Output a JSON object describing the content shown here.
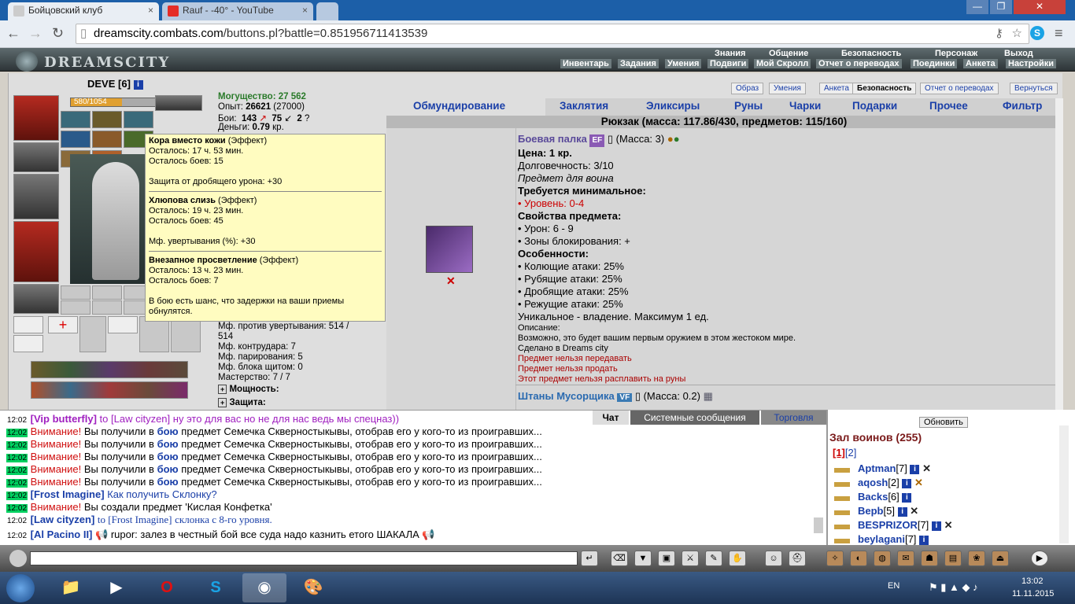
{
  "browser": {
    "tabs": [
      {
        "label": "Бойцовский клуб",
        "close": "×"
      },
      {
        "label": "Rauf - -40° - YouTube",
        "close": "×"
      }
    ],
    "window_buttons": [
      "—",
      "❐",
      "✕"
    ],
    "url_domain": "dreamscity.combats.com",
    "url_path": "/buttons.pl?battle=0.851956711413539"
  },
  "game": {
    "logo": "DREAMSCITY",
    "menu_top": [
      "Знания",
      "Общение",
      "Безопасность",
      "Персонаж",
      "Выход"
    ],
    "menu_bottom": [
      "Инвентарь",
      "Задания",
      "Умения",
      "Подвиги",
      "Мой Скролл",
      "Отчет о переводах",
      "Поединки",
      "Анкета",
      "Настройки"
    ]
  },
  "character": {
    "name": "DEVE",
    "level": "[6]",
    "hp": "580/1054",
    "might_label": "Могущество:",
    "might": "27 562",
    "exp_label": "Опыт:",
    "exp": "26621",
    "exp_next": "(27000)",
    "fights_label": "Бои:",
    "wins": "143",
    "losses": "75",
    "draws": "2",
    "money_label": "Деньги:",
    "money": "0.79",
    "money_unit": "кр.",
    "stats": [
      "Мф. против увертывания: 514 /",
      "514",
      "Мф. контрудара: 7",
      "Мф. парирования: 5",
      "Мф. блока щитом: 0",
      "Мастерство: 7 / 7"
    ],
    "power_label": "Мощность:",
    "defense_label": "Защита:"
  },
  "tooltip": {
    "effects": [
      {
        "name": "Кора вместо кожи",
        "type": "(Эффект)",
        "remain": "Осталось: 17 ч. 53 мин.",
        "fights": "Осталось боев: 15",
        "desc": "Защита от дробящего урона: +30"
      },
      {
        "name": "Хлюпова слизь",
        "type": "(Эффект)",
        "remain": "Осталось: 19 ч. 23 мин.",
        "fights": "Осталось боев: 45",
        "desc": "Мф. увертывания (%): +30"
      },
      {
        "name": "Внезапное просветление",
        "type": "(Эффект)",
        "remain": "Осталось: 13 ч. 23 мин.",
        "fights": "Осталось боев: 7",
        "desc": "В бою есть шанс, что задержки на ваши приемы обнулятся."
      }
    ]
  },
  "inventory": {
    "top_buttons": [
      "Образ",
      "Умения",
      "Анкета",
      "Безопасность",
      "Отчет о переводах",
      "Вернуться"
    ],
    "tabs": [
      "Обмундирование",
      "Заклятия",
      "Эликсиры",
      "Руны",
      "Чарки",
      "Подарки",
      "Прочее",
      "Фильтр"
    ],
    "backpack": "Рюкзак (масса: 117.86/430, предметов: 115/160)",
    "item": {
      "name": "Боевая палка",
      "tag": "EF",
      "mass": "(Масса: 3)",
      "price": "Цена: 1 кр.",
      "durability": "Долговечность: 3/10",
      "for_class": "Предмет для воина",
      "req_title": "Требуется минимальное:",
      "req_level": "• Уровень: 0-4",
      "props_title": "Свойства предмета:",
      "damage": "• Урон: 6 - 9",
      "block_zones": "• Зоны блокирования: +",
      "features_title": "Особенности:",
      "f1": "• Колющие атаки: 25%",
      "f2": "• Рубящие атаки: 25%",
      "f3": "• Дробящие атаки: 25%",
      "f4": "• Режущие атаки: 25%",
      "unique": "Уникальное - владение. Максимум 1 ед.",
      "desc_title": "Описание:",
      "desc": "Возможно, это будет вашим первым оружием в этом жестоком мире.",
      "made": "Сделано в Dreams city",
      "no_transfer": "Предмет нельзя передавать",
      "no_sell": "Предмет нельзя продать",
      "no_rune": "Этот предмет нельзя расплавить на руны",
      "delete": "✕"
    },
    "item2": {
      "name": "Штаны Мусорщика",
      "tag": "VF",
      "mass": "(Масса: 0.2)"
    }
  },
  "chat": {
    "tabs": [
      "Чат",
      "Системные сообщения",
      "Торговля"
    ],
    "lines": [
      {
        "time": "12:02",
        "name": "[Vip butterfly]",
        "to": "to [Law cityzen]",
        "text": "ну это для вас но не для нас ведь мы спецназ))"
      },
      {
        "time": "12:02",
        "warn": "Внимание!",
        "pre": "Вы получили в",
        "bold": "бою",
        "text": "предмет Семечка Скверностыкывы, отобрав его у кого-то из проигравших..."
      },
      {
        "time": "12:02",
        "warn": "Внимание!",
        "pre": "Вы получили в",
        "bold": "бою",
        "text": "предмет Семечка Скверностыкывы, отобрав его у кого-то из проигравших..."
      },
      {
        "time": "12:02",
        "warn": "Внимание!",
        "pre": "Вы получили в",
        "bold": "бою",
        "text": "предмет Семечка Скверностыкывы, отобрав его у кого-то из проигравших..."
      },
      {
        "time": "12:02",
        "warn": "Внимание!",
        "pre": "Вы получили в",
        "bold": "бою",
        "text": "предмет Семечка Скверностыкывы, отобрав его у кого-то из проигравших..."
      },
      {
        "time": "12:02",
        "warn": "Внимание!",
        "pre": "Вы получили в",
        "bold": "бою",
        "text": "предмет Семечка Скверностыкывы, отобрав его у кого-то из проигравших..."
      },
      {
        "time": "12:02",
        "name": "[Frost Imagine]",
        "text": "Как получить Склонку?"
      },
      {
        "time": "12:02",
        "warn": "Внимание!",
        "text": "Вы создали предмет 'Кислая Конфетка'"
      },
      {
        "time": "12:02",
        "name": "[Law cityzen]",
        "to": "to [Frost Imagine]",
        "text": "склонка с 8-го уровня."
      },
      {
        "time": "12:02",
        "name": "[Al Pacino II]",
        "text": "rupor: залез в честный бой все суда надо казнить етого ШАКАЛА"
      }
    ]
  },
  "online": {
    "refresh": "Обновить",
    "title": "Зал воинов (255)",
    "pages": [
      "[1]",
      "[2]"
    ],
    "users": [
      {
        "name": "Aptman",
        "level": "[7]"
      },
      {
        "name": "aqosh",
        "level": "[2]"
      },
      {
        "name": "Backs",
        "level": "[6]"
      },
      {
        "name": "Bepb",
        "level": "[5]"
      },
      {
        "name": "BESPRIZOR",
        "level": "[7]"
      },
      {
        "name": "beylagani",
        "level": "[7]"
      }
    ]
  },
  "taskbar": {
    "lang": "EN",
    "time": "13:02",
    "date": "11.11.2015"
  }
}
